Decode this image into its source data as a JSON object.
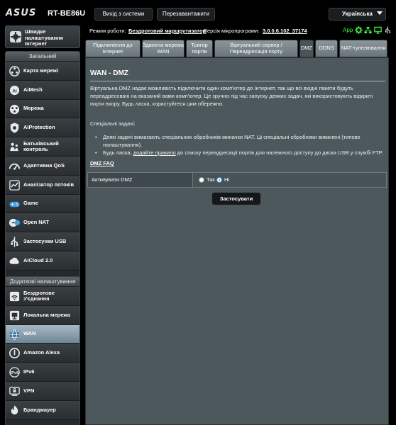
{
  "header": {
    "logo": "ASUS",
    "model": "RT-BE86U",
    "logout_label": "Вихід з системи",
    "reboot_label": "Перезавантажити",
    "language": "Українська"
  },
  "status": {
    "mode_label": "Режим роботи:",
    "mode_value": "Бездротовий маршрутизатор",
    "firmware_label": "Версія мікропрограми:",
    "firmware_value": "3.0.0.6.102_37174",
    "app_label": "App",
    "icons": [
      "gear-icon",
      "network-status-icon",
      "monitor-icon",
      "usb-icon"
    ],
    "accent_color": "#3cf53c"
  },
  "sidebar": {
    "quick_setup_label": "Швидке налаштування Інтернет",
    "general_title": "Загальний",
    "general_items": [
      {
        "label": "Карта мережі",
        "icon": "network-map-icon"
      },
      {
        "label": "AiMesh",
        "icon": "aimesh-icon"
      },
      {
        "label": "Мережа",
        "icon": "network-icon"
      },
      {
        "label": "AiProtection",
        "icon": "aiprotection-icon"
      },
      {
        "label": "Батьківський контроль",
        "icon": "parental-control-icon"
      },
      {
        "label": "Адаптивна QoS",
        "icon": "qos-icon"
      },
      {
        "label": "Аналізатор потоків",
        "icon": "traffic-analyzer-icon"
      },
      {
        "label": "Game",
        "icon": "game-icon"
      },
      {
        "label": "Open NAT",
        "icon": "open-nat-icon"
      },
      {
        "label": "Застосунки USB",
        "icon": "usb-apps-icon"
      },
      {
        "label": "AiCloud 2.0",
        "icon": "aicloud-icon"
      }
    ],
    "advanced_title": "Додаткові налаштування",
    "advanced_items": [
      {
        "label": "Бездротове з'єднання",
        "icon": "wireless-icon"
      },
      {
        "label": "Локальна мережа",
        "icon": "lan-icon"
      },
      {
        "label": "WAN",
        "icon": "wan-icon",
        "active": true
      },
      {
        "label": "Amazon Alexa",
        "icon": "alexa-icon"
      },
      {
        "label": "IPv6",
        "icon": "ipv6-icon"
      },
      {
        "label": "VPN",
        "icon": "vpn-icon"
      },
      {
        "label": "Брандмауер",
        "icon": "firewall-icon"
      }
    ]
  },
  "tabs": [
    {
      "label": "Підключення до Інтернет"
    },
    {
      "label": "Здвоєна мережа WAN"
    },
    {
      "label": "Тригер портів"
    },
    {
      "label": "Віртуальний сервер / Переадресація порту"
    },
    {
      "label": "DMZ",
      "active": true
    },
    {
      "label": "DDNS"
    },
    {
      "label": "NAT-тунелювання"
    }
  ],
  "content": {
    "title": "WAN - DMZ",
    "intro": "Віртуальна DMZ надає можливість підключити один комп'ютер до Інтернет, так що всі вхідні пакети будуть переадресовані на вказаний вами комп'ютер. Це зручно під час запуску деяких задач, які використовують відкриті порти вхору. Будь ласка, користуйтеся цим обережно.",
    "special_title": "Спеціальні задачі:",
    "note1": "Деякі задачі вимагають спеціальних обробників миначки NAT. Ці спеціальні обробники вимкнені (типове налаштування).",
    "note2_pre": "Будь ласка, ",
    "note2_link": "додайте правило",
    "note2_post": " до списку переадресації портів для належного доступу до диска USB у службі FTP.",
    "faq_link": "DMZ FAQ",
    "enable_label": "Активувати DMZ",
    "option_yes": "Так",
    "option_no": "Ні",
    "selected": "Ні",
    "apply_label": "Застосувати"
  }
}
